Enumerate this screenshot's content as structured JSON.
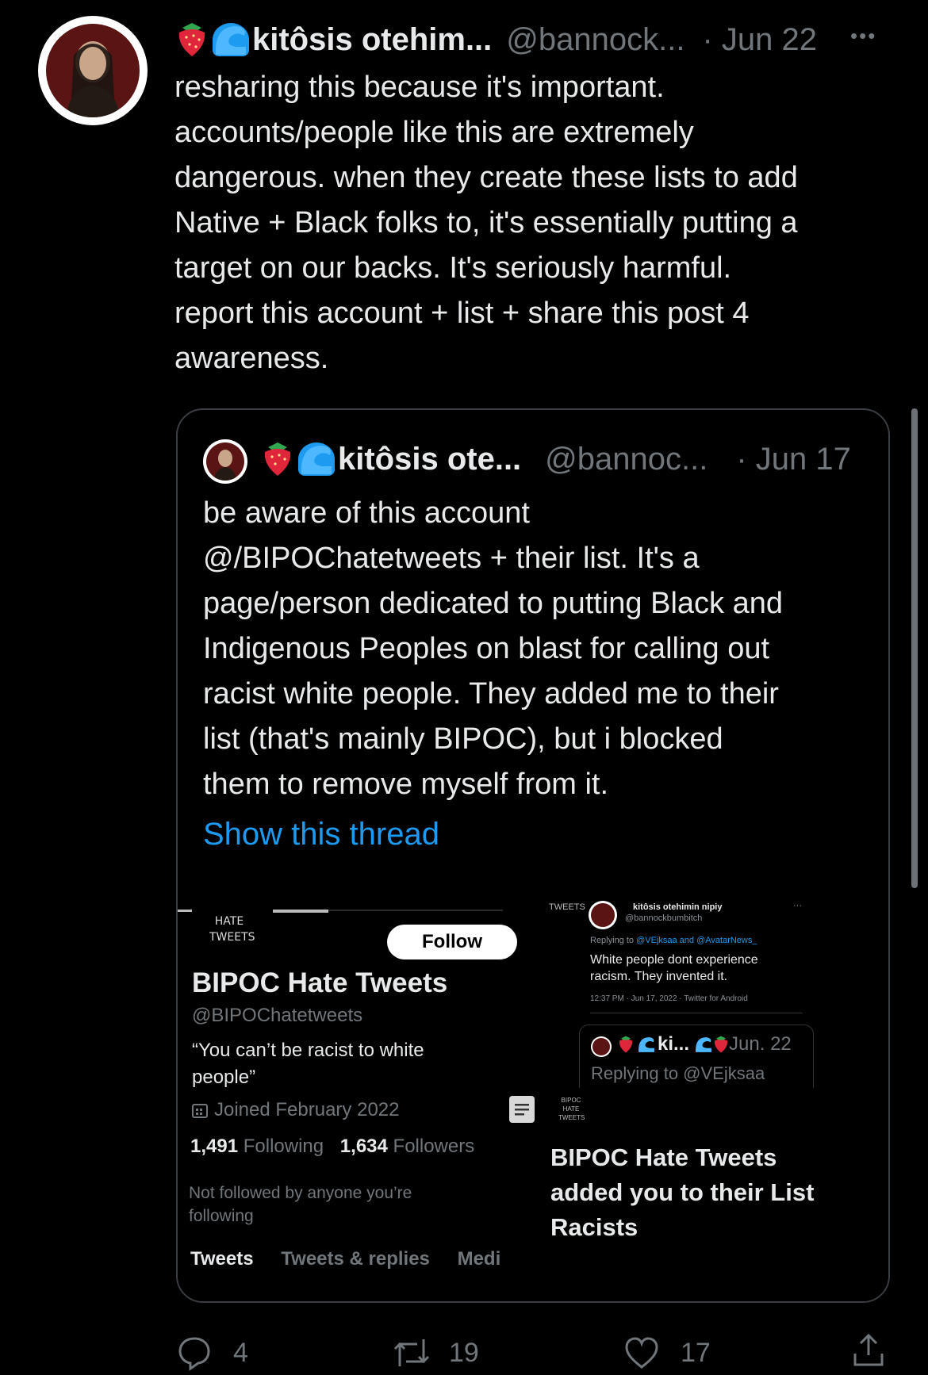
{
  "tweet": {
    "display_name": "kitôsis otehim...",
    "handle": "@bannock...",
    "date": "· Jun 22",
    "more": "•••",
    "text_lines": [
      "resharing this because it's important.",
      "accounts/people like this are extremely",
      "dangerous. when they create these lists to add",
      "Native + Black folks to, it's essentially putting a",
      "target on our backs. It's seriously harmful.",
      "report this account + list + share this post 4",
      "awareness."
    ]
  },
  "quoted": {
    "display_name": "kitôsis ote...",
    "handle": "@bannoc...",
    "date": "· Jun 17",
    "text_lines": [
      "be aware of this account",
      "@/BIPOChatetweets + their list. It's a",
      "page/person dedicated to putting Black and",
      "Indigenous Peoples on blast for calling out",
      "racist white people. They added me to their",
      "list (that's mainly BIPOC), but i blocked",
      "them to remove myself from it."
    ],
    "show_thread": "Show this thread"
  },
  "profile_screenshot": {
    "logo_text": "HATE TWEETS",
    "follow_button": "Follow",
    "name": "BIPOC Hate Tweets",
    "handle": "@BIPOChatetweets",
    "bio": "“You can’t be racist to white people”",
    "joined": "Joined February 2022",
    "following_count": "1,491",
    "following_label": "Following",
    "followers_count": "1,634",
    "followers_label": "Followers",
    "not_followed": "Not followed by anyone you’re following",
    "tabs": [
      "Tweets",
      "Tweets & replies",
      "Medi"
    ]
  },
  "reply_screenshot": {
    "logo_text": "TWEETS",
    "name": "kitôsis otehimin nipiy",
    "handle": "@bannockbumbitch",
    "more": "···",
    "replying_prefix": "Replying to",
    "replying_users": "@VEjksaa and @AvatarNews_",
    "text_line1": "White people dont experience",
    "text_line2": "racism. They invented it.",
    "meta": "12:37 PM · Jun 17, 2022 · Twitter for Android",
    "nested_name": "ki...",
    "nested_date": "Jun. 22",
    "nested_replying": "Replying to @VEjksaa"
  },
  "list_notification": {
    "logo_text": "BIPOC HATE TWEETS",
    "line1": "BIPOC Hate Tweets",
    "line2": "added you to their List",
    "line3": "Racists"
  },
  "actions": {
    "reply_count": "4",
    "retweet_count": "19",
    "like_count": "17"
  },
  "colors": {
    "background": "#000000",
    "text": "#e7e9ea",
    "muted": "#71767b",
    "link": "#1d9bf0",
    "border": "#3a3d41"
  }
}
